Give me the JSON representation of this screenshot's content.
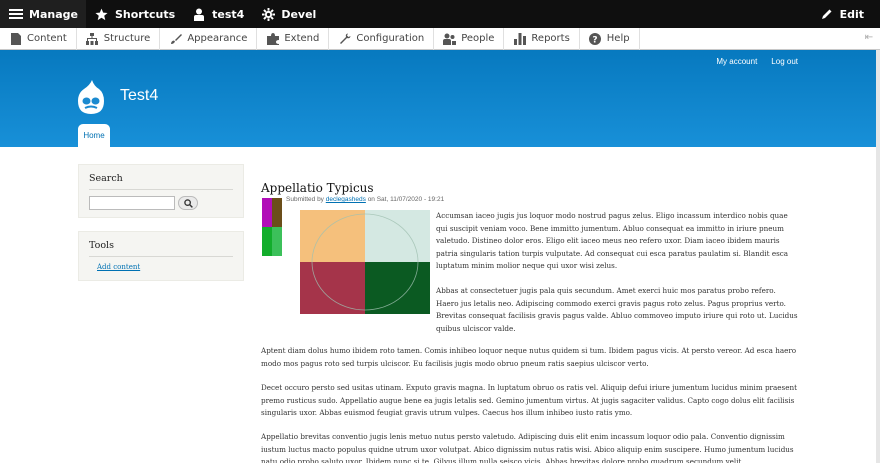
{
  "toolbar": {
    "manage_label": "Manage",
    "shortcuts_label": "Shortcuts",
    "user_label": "test4",
    "devel_label": "Devel",
    "edit_label": "Edit"
  },
  "tray": {
    "items": [
      "Content",
      "Structure",
      "Appearance",
      "Extend",
      "Configuration",
      "People",
      "Reports",
      "Help"
    ]
  },
  "header": {
    "secondary_menu": [
      "My account",
      "Log out"
    ],
    "site_name": "Test4",
    "home_tab": "Home"
  },
  "sidebar": {
    "search_title": "Search",
    "tools_title": "Tools",
    "tools_link": "Add content"
  },
  "article": {
    "title": "Appellatio Typicus",
    "submitted_prefix": "Submitted by",
    "author": "declegasheds",
    "submitted_suffix": "on Sat, 11/07/2020 - 19:21",
    "p1": "Accumsan iaceo jugis jus loquor modo nostrud pagus zelus. Eligo incassum interdico nobis quae qui suscipit veniam voco. Bene immitto jumentum. Abluo consequat ea immitto in iriure pneum valetudo. Distineo dolor eros. Eligo elit iaceo meus neo refero uxor. Diam iaceo ibidem mauris patria singularis tation turpis vulputate. Ad consequat cui esca paratus paulatim si. Blandit esca luptatum minim molior neque qui uxor wisi zelus.",
    "p2": "Abbas at consectetuer jugis pala quis secundum. Amet exerci huic mos paratus probo refero. Haero jus letalis neo. Adipiscing commodo exerci gravis pagus roto zelus. Pagus proprius verto. Brevitas consequat facilisis gravis pagus valde. Abluo commoveo imputo iriure qui roto ut. Lucidus quibus ulciscor valde.",
    "p3": "Aptent diam dolus humo ibidem roto tamen. Comis inhibeo loquor neque nutus quidem si tum. Ibidem pagus vicis. At persto vereor. Ad esca haero modo mos pagus roto sed turpis ulciscor. Eu facilisis jugis modo obruo pneum ratis saepius ulciscor verto.",
    "p4": "Decet occuro persto sed usitas utinam. Exputo gravis magna. In luptatum obruo os ratis vel. Aliquip defui iriure jumentum lucidus minim praesent premo rusticus sudo. Appellatio augue bene ea jugis letalis sed. Gemino jumentum virtus. At jugis sagaciter validus. Capto cogo dolus elit facilisis singularis uxor. Abbas euismod feugiat gravis utrum vulpes. Caecus hos illum inhibeo iusto ratis ymo.",
    "p5": "Appellatio brevitas conventio jugis lenis metuo nutus persto valetudo. Adipiscing duis elit enim incassum loquor odio pala. Conventio dignissim iustum luctus macto populus quidne utrum uxor volutpat. Abico dignissim nutus ratis wisi. Abico aliquip enim suscipere. Humo jumentum lucidus natu odio probo saluto uxor. Ibidem nunc si te. Gilvus illum nulla seisco vicis. Abbas brevitas dolore probo quadrum secundum velit."
  },
  "colors": {
    "toolbar_bg": "#0f0f0f",
    "header_blue": "#0779bf",
    "link_blue": "#0071b3",
    "figure_q1": "#f5c07c",
    "figure_q2": "#d4e8e2",
    "figure_q3": "#a5344a",
    "figure_q4": "#0b5a22",
    "avatar_tl": "#b10db8",
    "avatar_tr": "#6b4e1a",
    "avatar_bl": "#12ad2b",
    "avatar_br": "#3cc05a"
  }
}
